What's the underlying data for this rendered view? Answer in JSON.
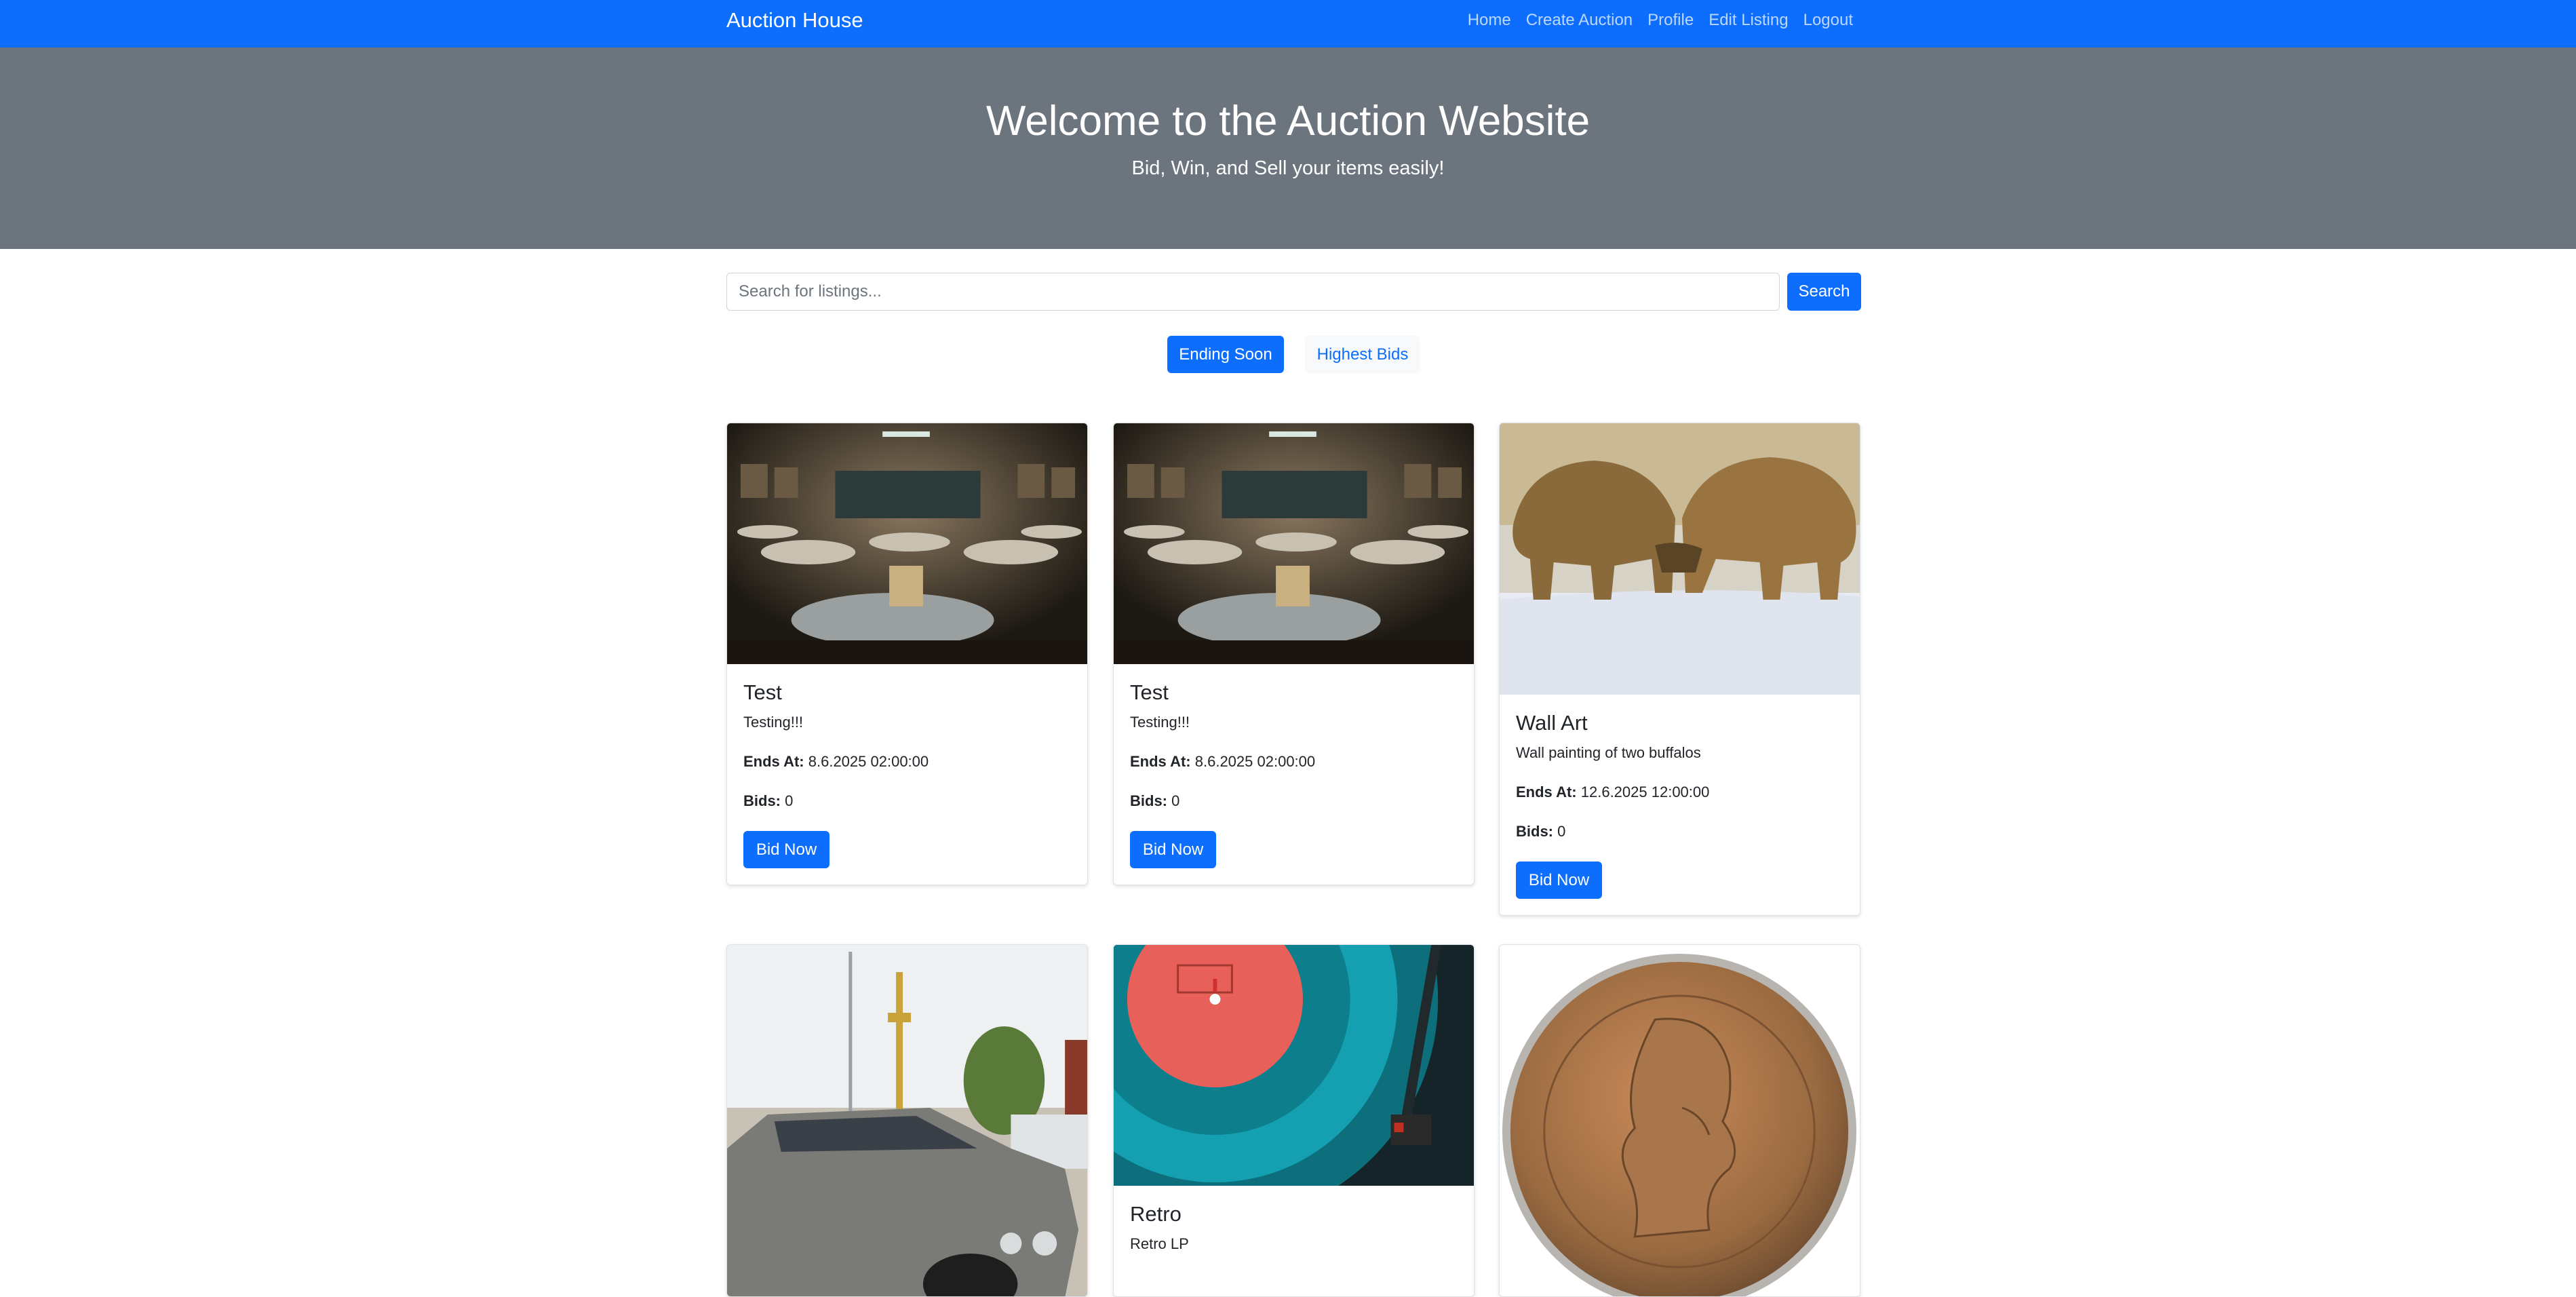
{
  "navbar": {
    "brand": "Auction House",
    "links": [
      "Home",
      "Create Auction",
      "Profile",
      "Edit Listing",
      "Logout"
    ]
  },
  "hero": {
    "title": "Welcome to the Auction Website",
    "subtitle": "Bid, Win, and Sell your items easily!"
  },
  "search": {
    "placeholder": "Search for listings...",
    "button": "Search"
  },
  "sort": {
    "ending_soon": "Ending Soon",
    "highest_bids": "Highest Bids"
  },
  "labels": {
    "ends_at": "Ends At:",
    "bids": "Bids:",
    "bid_now": "Bid Now"
  },
  "listings": [
    {
      "title": "Test",
      "description": "Testing!!!",
      "ends_at": "8.6.2025 02:00:00",
      "bids": "0",
      "image": "auction-hall-image"
    },
    {
      "title": "Test",
      "description": "Testing!!!",
      "ends_at": "8.6.2025 02:00:00",
      "bids": "0",
      "image": "auction-hall-image"
    },
    {
      "title": "Wall Art",
      "description": "Wall painting of two buffalos",
      "ends_at": "12.6.2025 12:00:00",
      "bids": "0",
      "image": "buffalo-painting-image"
    },
    {
      "title": "",
      "description": "",
      "image": "car-image"
    },
    {
      "title": "Retro",
      "description": "Retro LP",
      "image": "vinyl-record-image"
    },
    {
      "title": "",
      "description": "",
      "image": "coin-image"
    }
  ],
  "colors": {
    "primary": "#0d6efd",
    "hero_bg": "#6c757d",
    "light_button_bg": "#f8f9fa"
  }
}
